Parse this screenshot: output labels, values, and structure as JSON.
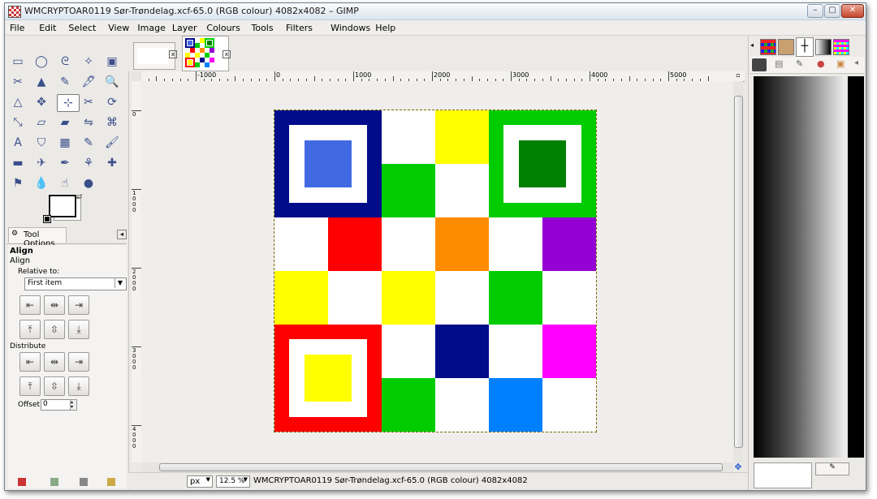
{
  "window": {
    "title": "WMCRYPTOAR0119 Sør-Trøndelag.xcf-65.0 (RGB colour) 4082x4082 – GIMP",
    "controls": {
      "minimize": "–",
      "maximize": "▢",
      "close": "✕"
    }
  },
  "menu": [
    "File",
    "Edit",
    "Select",
    "View",
    "Image",
    "Layer",
    "Colours",
    "Tools",
    "Filters",
    "Windows",
    "Help"
  ],
  "tools": [
    [
      "rect-select-icon",
      "ellipse-select-icon",
      "free-select-icon",
      "fuzzy-select-icon",
      "color-select-icon"
    ],
    [
      "scissors-icon",
      "foreground-select-icon",
      "paths-icon",
      "color-picker-icon",
      "zoom-icon"
    ],
    [
      "measure-icon",
      "move-icon",
      "align-icon",
      "crop-icon",
      "rotate-icon"
    ],
    [
      "scale-icon",
      "shear-icon",
      "perspective-icon",
      "flip-icon",
      "cage-icon"
    ],
    [
      "text-icon",
      "bucket-fill-icon",
      "blend-icon",
      "pencil-icon",
      "paintbrush-icon"
    ],
    [
      "eraser-icon",
      "airbrush-icon",
      "ink-icon",
      "clone-icon",
      "heal-icon"
    ],
    [
      "perspective-clone-icon",
      "blur-icon",
      "smudge-icon",
      "dodge-burn-icon"
    ]
  ],
  "tool_glyphs": [
    [
      "▭",
      "◯",
      "ᘓ",
      "✧",
      "▣"
    ],
    [
      "✂",
      "▲",
      "✎",
      "🖋",
      "🔍"
    ],
    [
      "△",
      "✥",
      "⊹",
      "✂",
      "⟳"
    ],
    [
      "⤡",
      "▱",
      "▰",
      "⇋",
      "⌘"
    ],
    [
      "A",
      "⛉",
      "▦",
      "✎",
      "🖌"
    ],
    [
      "▬",
      "✈",
      "✒",
      "⚘",
      "✚"
    ],
    [
      "⚑",
      "💧",
      "☝",
      "●"
    ]
  ],
  "tool_options": {
    "tab_label": "Tool Options",
    "heading": "Align",
    "sub_heading": "Align",
    "relative_to_label": "Relative to:",
    "relative_to_value": "First item",
    "distribute_label": "Distribute",
    "offset_label": "Offset:",
    "offset_value": "0"
  },
  "ruler": {
    "h_labels": [
      "-1000",
      "0",
      "1000",
      "2000",
      "3000",
      "4000",
      "5000"
    ],
    "v_labels": [
      "0",
      "1000",
      "2000",
      "3000",
      "4000"
    ]
  },
  "image_grid": {
    "colors": {
      "navy": "#000c8a",
      "blue": "#4169e1",
      "green": "#00cc00",
      "dark_green": "#008000",
      "yellow": "#ffff00",
      "red": "#ff0000",
      "orange": "#ff8c00",
      "purple": "#9400d3",
      "magenta": "#ff00ff",
      "azure": "#0080ff",
      "white": "#ffffff"
    },
    "cells": [
      [
        "white",
        "white",
        "white",
        "yellow",
        "white",
        "white"
      ],
      [
        "white",
        "white",
        "green",
        "white",
        "white",
        "white"
      ],
      [
        "white",
        "red",
        "white",
        "orange",
        "white",
        "purple"
      ],
      [
        "yellow",
        "white",
        "yellow",
        "white",
        "green",
        "white"
      ],
      [
        "white",
        "white",
        "white",
        "navy",
        "white",
        "magenta"
      ],
      [
        "white",
        "white",
        "green",
        "white",
        "azure",
        "white"
      ]
    ],
    "quads": [
      {
        "outer": "navy",
        "inner": "blue"
      },
      {
        "outer": "green",
        "inner": "dark_green"
      },
      {
        "outer": "red",
        "inner": "yellow"
      }
    ]
  },
  "status": {
    "unit": "px",
    "zoom": "12.5 %",
    "text": "WMCRYPTOAR0119 Sør-Trøndelag.xcf-65.0 (RGB colour) 4082x4082"
  }
}
